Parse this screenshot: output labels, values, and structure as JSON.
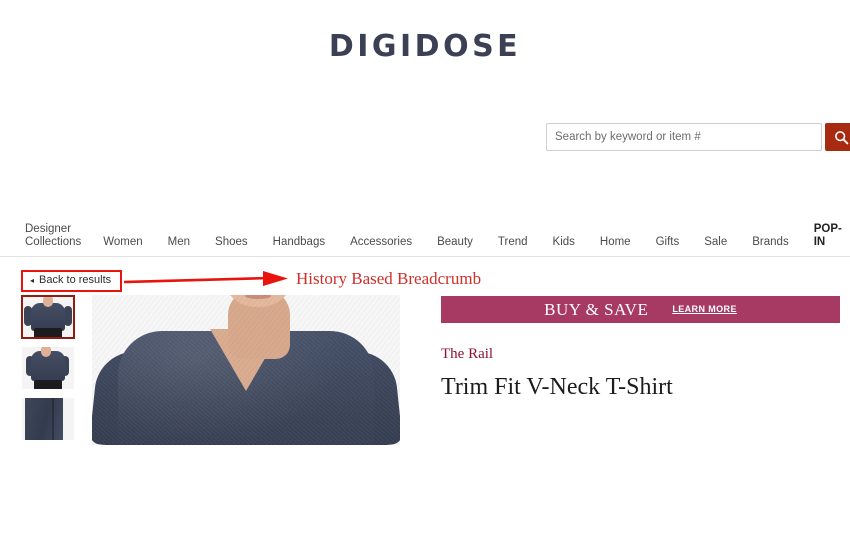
{
  "brand_logo": {
    "text": "DIGIDOSE",
    "color": "#3b4055"
  },
  "search": {
    "placeholder": "Search by keyword or item #",
    "value": "",
    "button_icon": "search-icon",
    "button_color": "#a82a10"
  },
  "nav": {
    "items": [
      {
        "label": "Designer\nCollections",
        "bold": false
      },
      {
        "label": "Women",
        "bold": false
      },
      {
        "label": "Men",
        "bold": false
      },
      {
        "label": "Shoes",
        "bold": false
      },
      {
        "label": "Handbags",
        "bold": false
      },
      {
        "label": "Accessories",
        "bold": false
      },
      {
        "label": "Beauty",
        "bold": false
      },
      {
        "label": "Trend",
        "bold": false
      },
      {
        "label": "Kids",
        "bold": false
      },
      {
        "label": "Home",
        "bold": false
      },
      {
        "label": "Gifts",
        "bold": false
      },
      {
        "label": "Sale",
        "bold": false
      },
      {
        "label": "Brands",
        "bold": false
      },
      {
        "label": "POP-IN",
        "bold": true
      }
    ]
  },
  "breadcrumb": {
    "back_label": "Back to results",
    "back_arrow": "◂",
    "highlight_color": "#e8140d"
  },
  "annotation": {
    "label": "History Based Breadcrumb",
    "color": "#d02f2a"
  },
  "gallery": {
    "thumbnails": [
      {
        "alt": "model-front-view",
        "selected": true
      },
      {
        "alt": "model-side-view",
        "selected": false
      },
      {
        "alt": "fabric-closeup",
        "selected": false
      }
    ],
    "main_image_alt": "man-wearing-navy-v-neck-t-shirt"
  },
  "promo": {
    "title": "BUY & SAVE",
    "link_label": "LEARN MORE",
    "background": "#a73a63"
  },
  "product": {
    "brand": "The Rail",
    "brand_color": "#8c1230",
    "title": "Trim Fit V-Neck T-Shirt"
  }
}
